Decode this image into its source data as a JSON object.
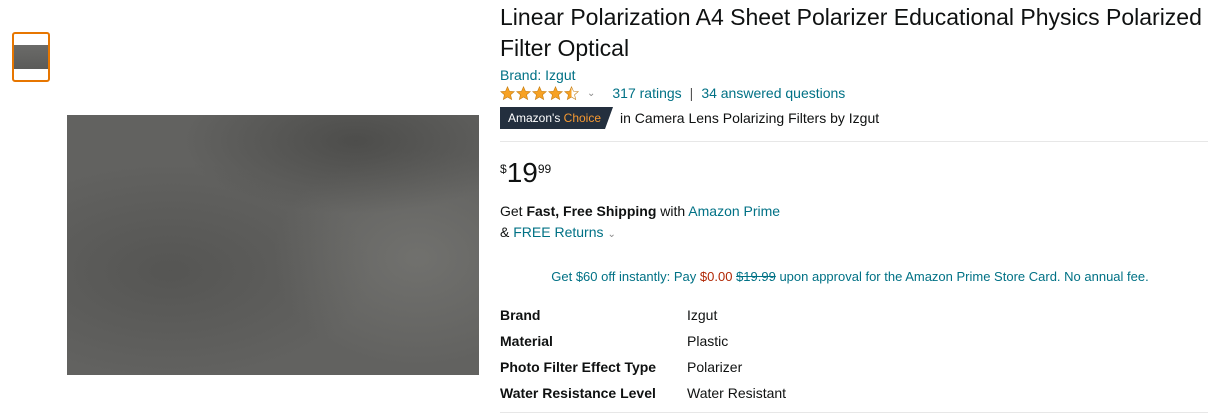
{
  "product": {
    "title": "Linear Polarization A4 Sheet Polarizer Educational Physics Polarized Filter Optical",
    "brand_link": "Brand: Izgut",
    "rating": 4.5,
    "ratings_count": "317 ratings",
    "separator": "|",
    "answered_questions": "34 answered questions",
    "badge": {
      "prefix": "Amazon's",
      "suffix": "Choice"
    },
    "choice_text": "in Camera Lens Polarizing Filters by Izgut",
    "price": {
      "symbol": "$",
      "whole": "19",
      "fraction": "99"
    },
    "shipping": {
      "get": "Get ",
      "bold": "Fast, Free Shipping",
      "with": " with ",
      "prime_link": "Amazon Prime",
      "amp": "& ",
      "returns_link": "FREE Returns"
    },
    "promo": {
      "pre": "Get $60 off instantly: Pay ",
      "pay": "$0.00",
      "space": " ",
      "original": "$19.99",
      "post": " upon approval for the Amazon Prime Store Card. No annual fee."
    },
    "specs": [
      {
        "key": "Brand",
        "value": "Izgut"
      },
      {
        "key": "Material",
        "value": "Plastic"
      },
      {
        "key": "Photo Filter Effect Type",
        "value": "Polarizer"
      },
      {
        "key": "Water Resistance Level",
        "value": "Water Resistant"
      }
    ]
  },
  "colors": {
    "accent": "#e77600",
    "link": "#007185",
    "star": "#f7a224",
    "badge_bg": "#232f3e",
    "badge_choice": "#f69931",
    "price_red": "#b12704"
  },
  "icons": {
    "stars": "star-rating-icon",
    "chevron": "chevron-down-icon"
  }
}
